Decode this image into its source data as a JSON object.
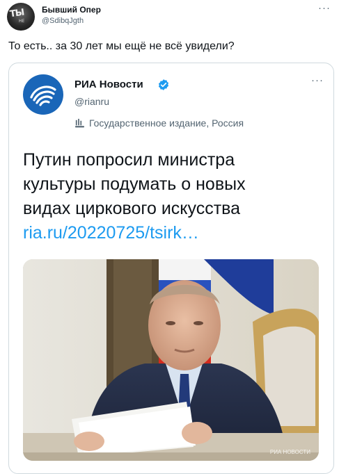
{
  "author": {
    "name": "Бывший Опер",
    "handle": "@SdibqJgth",
    "avatar_text": "ТЫ",
    "avatar_subtext": "НЕ"
  },
  "tweet": {
    "text": "То есть.. за 30 лет мы ещё не всё увидели?",
    "more_icon": "···"
  },
  "quoted": {
    "name": "РИА Новости",
    "handle": "@rianru",
    "label": "Государственное издание, Россия",
    "more_icon": "···",
    "headline_lines": [
      "Путин попросил министра",
      "культуры подумать о новых",
      "видах циркового искусства"
    ],
    "link": "ria.ru/20220725/tsirk…",
    "watermark": "РИА НОВОСТИ"
  },
  "colors": {
    "link": "#1d9bf0",
    "verified": "#1d9bf0",
    "ria_logo": "#1a66b8",
    "muted": "#536471"
  }
}
